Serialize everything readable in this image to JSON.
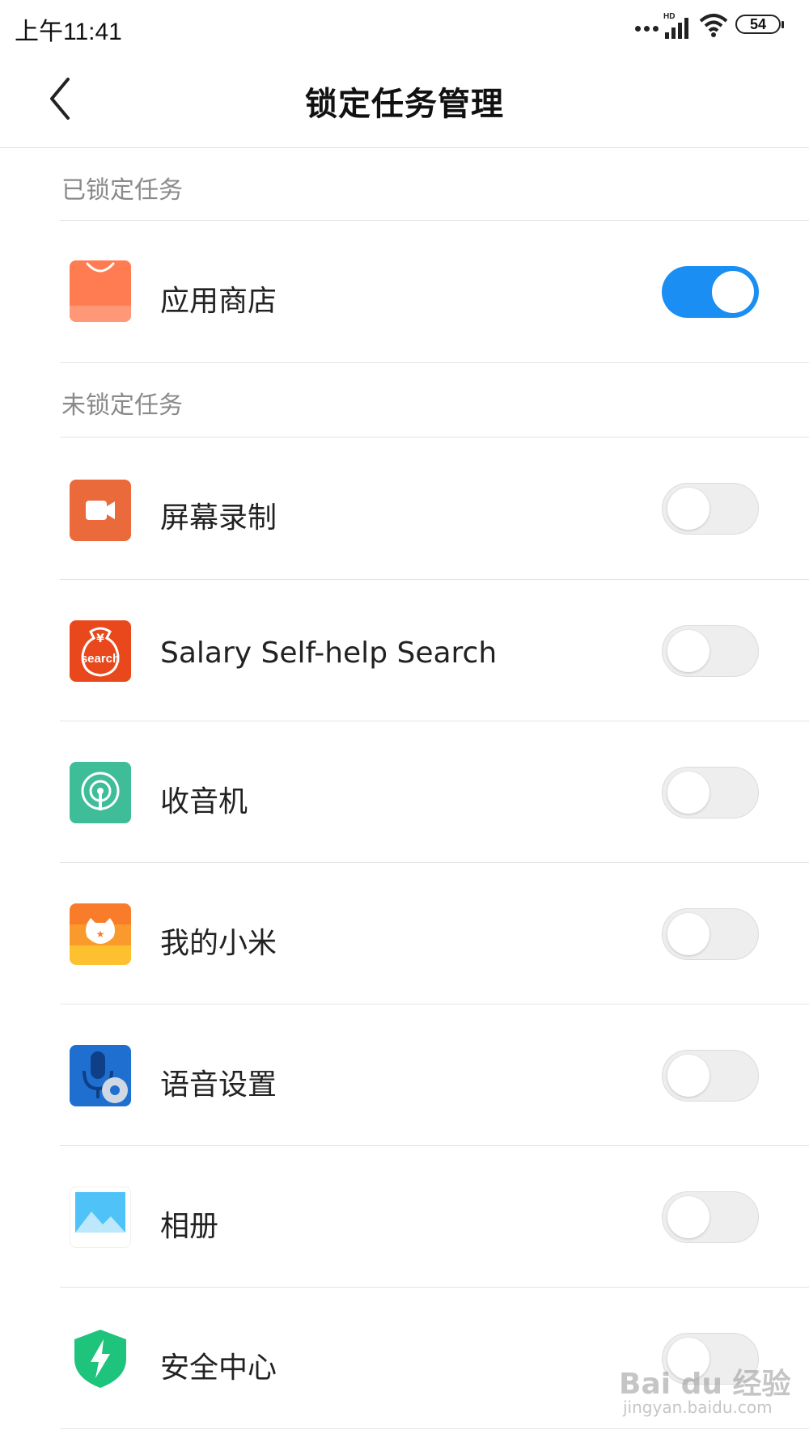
{
  "status_bar": {
    "time": "上午11:41",
    "network_label": "HD",
    "battery": "54"
  },
  "header": {
    "title": "锁定任务管理",
    "back_icon": "chevron-left-icon"
  },
  "locked_section": {
    "title": "已锁定任务",
    "items": [
      {
        "label": "应用商店",
        "icon": "app-store-icon",
        "locked": true
      }
    ]
  },
  "unlocked_section": {
    "title": "未锁定任务",
    "items": [
      {
        "label": "屏幕录制",
        "icon": "screen-recorder-icon",
        "locked": false
      },
      {
        "label": "Salary Self-help Search",
        "icon": "salary-search-icon",
        "locked": false
      },
      {
        "label": "收音机",
        "icon": "radio-icon",
        "locked": false
      },
      {
        "label": "我的小米",
        "icon": "mi-account-icon",
        "locked": false
      },
      {
        "label": "语音设置",
        "icon": "voice-settings-icon",
        "locked": false
      },
      {
        "label": "相册",
        "icon": "gallery-icon",
        "locked": false
      },
      {
        "label": "安全中心",
        "icon": "security-center-icon",
        "locked": false
      }
    ]
  },
  "colors": {
    "toggle_on": "#1a8ef2",
    "toggle_off": "#eeeeee",
    "section_text": "#8a8a8a"
  },
  "watermark": {
    "main": "Bai du 经验",
    "sub": "jingyan.baidu.com"
  }
}
